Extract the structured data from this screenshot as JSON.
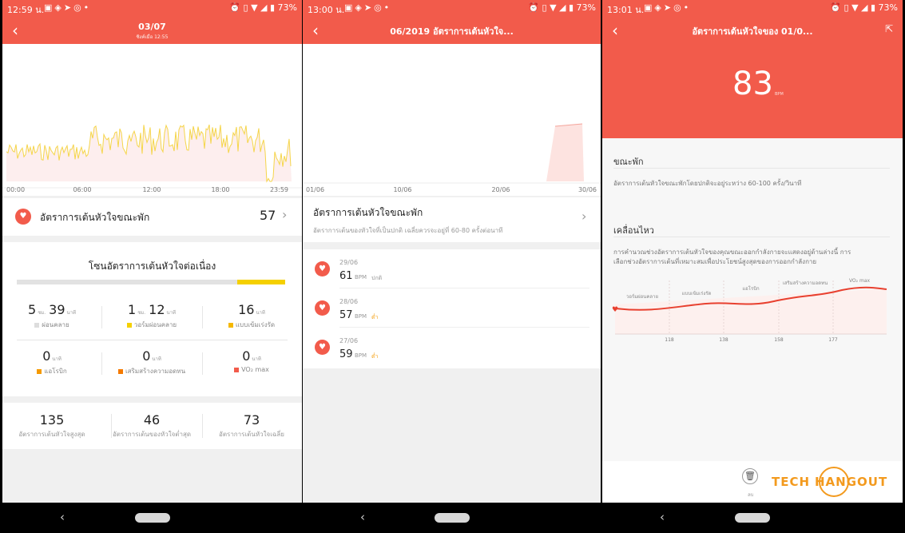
{
  "screen1": {
    "status": {
      "time": "12:59 น.",
      "battery": "73%"
    },
    "header": {
      "title": "03/07",
      "subtitle": "ซิงค์เมื่อ 12:55"
    },
    "chart_data": {
      "type": "line",
      "x_labels": [
        "00:00",
        "06:00",
        "12:00",
        "18:00",
        "23:59"
      ],
      "color": "#f5d54a"
    },
    "resting": {
      "label": "อัตราการเต้นหัวใจขณะพัก",
      "value": "57"
    },
    "zones": {
      "title": "โซนอัตราการเต้นหัวใจต่อเนื่อง",
      "bar_fill_fraction": 0.18,
      "items": [
        {
          "h": "5",
          "hu": "ชม.",
          "m": "39",
          "mu": "นาที",
          "label": "ผ่อนคลาย",
          "color": "#dddddd"
        },
        {
          "h": "1",
          "hu": "ชม.",
          "m": "12",
          "mu": "นาที",
          "label": "วอร์มผ่อนคลาย",
          "color": "#f5d000"
        },
        {
          "h": "",
          "hu": "",
          "m": "16",
          "mu": "นาที",
          "label": "แบบเข้มเร่งรัด",
          "color": "#f5b800"
        },
        {
          "h": "",
          "hu": "",
          "m": "0",
          "mu": "นาที",
          "label": "แอโรบิก",
          "color": "#f59a00"
        },
        {
          "h": "",
          "hu": "",
          "m": "0",
          "mu": "นาที",
          "label": "เสริมสร้างความอดทน",
          "color": "#f57a00"
        },
        {
          "h": "",
          "hu": "",
          "m": "0",
          "mu": "นาที",
          "label": "VO₂ max",
          "color": "#f25b4b"
        }
      ]
    },
    "stats": [
      {
        "value": "135",
        "label": "อัตราการเต้นหัวใจสูงสุด"
      },
      {
        "value": "46",
        "label": "อัตราการเต้นของหัวใจต่ำสุด"
      },
      {
        "value": "73",
        "label": "อัตราการเต้นหัวใจเฉลี่ย"
      }
    ]
  },
  "screen2": {
    "status": {
      "time": "13:00 น.",
      "battery": "73%"
    },
    "header": {
      "title": "06/2019 อัตราการเต้นหัวใจ..."
    },
    "chart_data": {
      "type": "area",
      "x_labels": [
        "01/06",
        "10/06",
        "20/06",
        "30/06"
      ],
      "color": "#f7c6c0"
    },
    "resting": {
      "label": "อัตราการเต้นหัวใจขณะพัก",
      "desc": "อัตราการเต้นของหัวใจที่เป็นปกติ เฉลี่ยควรจะอยู่ที่ 60-80 ครั้งต่อนาที"
    },
    "records": [
      {
        "date": "29/06",
        "value": "61",
        "unit": "BPM",
        "tag": "ปกติ"
      },
      {
        "date": "28/06",
        "value": "57",
        "unit": "BPM",
        "tag": "ต่ำ"
      },
      {
        "date": "27/06",
        "value": "59",
        "unit": "BPM",
        "tag": "ต่ำ"
      }
    ]
  },
  "screen3": {
    "status": {
      "time": "13:01 น.",
      "battery": "73%"
    },
    "header": {
      "title": "อัตราการเต้นหัวใจของ 01/0...",
      "value": "83",
      "unit": "BPM"
    },
    "rest": {
      "title": "ขณะพัก",
      "desc": "อัตราการเต้นหัวใจขณะพักโดยปกติจะอยู่ระหว่าง 60-100 ครั้ง/วินาที"
    },
    "move": {
      "title": "เคลื่อนไหว",
      "desc1": "การคำนวณช่วงอัตราการเต้นหัวใจของคุณขณะออกกำลังกายจะแสดงอยู่ด้านล่างนี้ การ",
      "desc2": "เลือกช่วงอัตราการเต้นที่เหมาะสมเพื่อประโยชน์สูงสุดของการออกกำลังกาย"
    },
    "zones_chart": {
      "labels": [
        "วอร์มผ่อนคลาย",
        "แบบเข้มเร่งรัด",
        "แอโรบิก",
        "เสริมสร้างความอดทน",
        "VO₂ max"
      ],
      "ticks": [
        "118",
        "138",
        "158",
        "177"
      ]
    },
    "delete_label": "ลบ",
    "watermark": "TECHHANGOUT"
  }
}
